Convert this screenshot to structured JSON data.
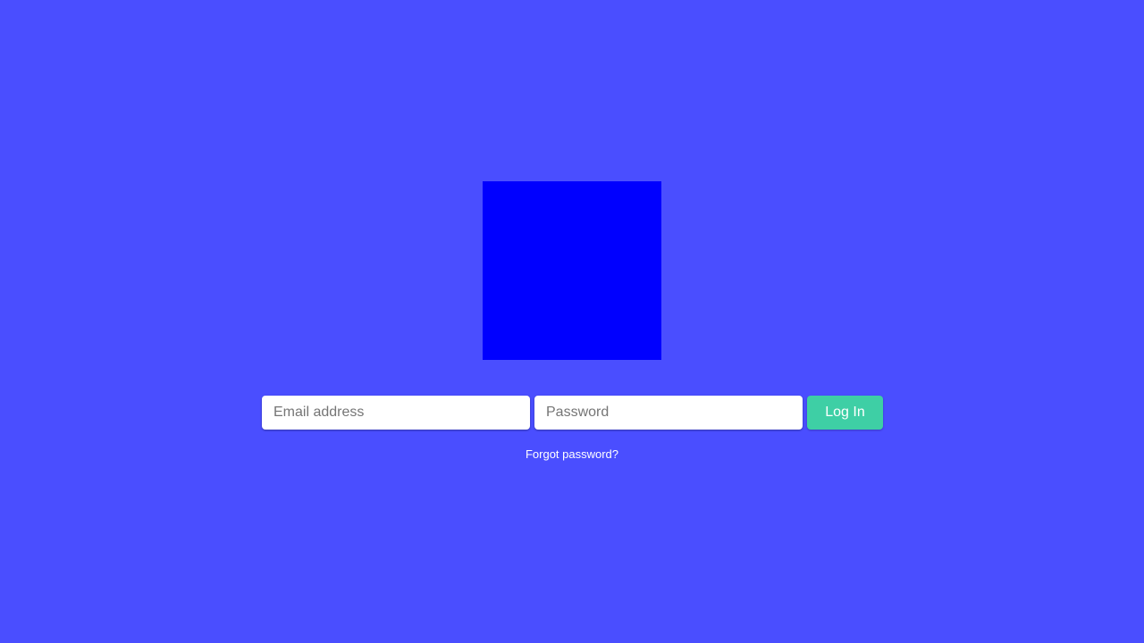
{
  "colors": {
    "background": "#4a4eff",
    "logo": "#0000ff",
    "login_button": "#3ecfa5",
    "input_background": "#ffffff",
    "text_light": "#ffffff"
  },
  "logo": {
    "icon": "logo-square"
  },
  "login_form": {
    "email": {
      "placeholder": "Email address",
      "value": ""
    },
    "password": {
      "placeholder": "Password",
      "value": ""
    },
    "submit_label": "Log In"
  },
  "forgot_password": {
    "label": "Forgot password?"
  }
}
